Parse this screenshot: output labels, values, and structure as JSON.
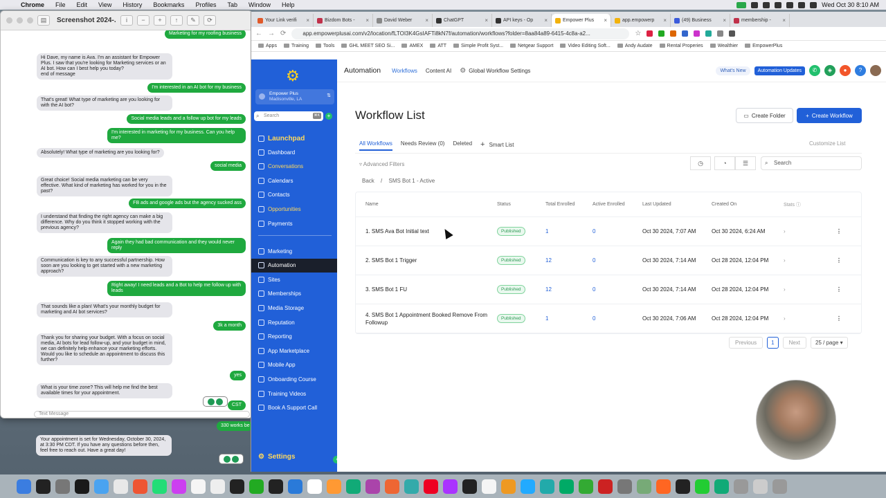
{
  "menubar": {
    "app": "Chrome",
    "menus": [
      "File",
      "Edit",
      "View",
      "History",
      "Bookmarks",
      "Profiles",
      "Tab",
      "Window",
      "Help"
    ],
    "clock": "Wed Oct 30 8:10 AM"
  },
  "screenshot_window": {
    "title": "Screenshot 2024-...",
    "input_placeholder": "Text Message",
    "messages": [
      {
        "from": "out",
        "text": "Marketing for my roofing business"
      },
      {
        "from": "in",
        "text": "Hi Dave, my name is Ava. I'm an assistant for Empower Plus. I saw that you're looking for Marketing services or an AI bot. How can I best help you today?\nend of message"
      },
      {
        "from": "out",
        "text": "I'm interested in an AI bot for my business"
      },
      {
        "from": "in",
        "text": "That's great! What type of marketing are you looking for with the AI bot?"
      },
      {
        "from": "out",
        "text": "Social media leads and a follow up bot for my leads"
      },
      {
        "from": "out",
        "text": "I'm interested in marketing for my business. Can you help me?"
      },
      {
        "from": "in",
        "text": "Absolutely! What type of marketing are you looking for?"
      },
      {
        "from": "out",
        "text": "social media"
      },
      {
        "from": "in",
        "text": "Great choice! Social media marketing can be very effective. What kind of marketing has worked for you in the past?"
      },
      {
        "from": "out",
        "text": "FB ads and google ads but the agency sucked ass"
      },
      {
        "from": "in",
        "text": "I understand that finding the right agency can make a big difference. Why do you think it stopped working with the previous agency?"
      },
      {
        "from": "out",
        "text": "Again they had bad communication and they would never reply"
      },
      {
        "from": "in",
        "text": "Communication is key to any successful partnership. How soon are you looking to get started with a new marketing approach?"
      },
      {
        "from": "out",
        "text": "Right away! I need leads and a Bot to help me follow up with leads"
      },
      {
        "from": "in",
        "text": "That sounds like a plan! What's your monthly budget for marketing and AI bot services?"
      },
      {
        "from": "out",
        "text": "3k a month"
      },
      {
        "from": "in",
        "text": "Thank you for sharing your budget. With a focus on social media, AI bots for lead follow-up, and your budget in mind, we can definitely help enhance your marketing efforts. Would you like to schedule an appointment to discuss this further?"
      },
      {
        "from": "out",
        "text": "yes"
      },
      {
        "from": "in",
        "text": "What is your time zone? This will help me find the best available times for your appointment."
      },
      {
        "from": "out",
        "text": "CST"
      }
    ],
    "below_messages": [
      {
        "from": "out",
        "text": "330 works be"
      },
      {
        "from": "in",
        "text": "Your appointment is set for Wednesday, October 30, 2024, at 3:30 PM CDT. If you have any questions before then, feel free to reach out. Have a great day!"
      }
    ]
  },
  "browser": {
    "tabs": [
      {
        "label": "Your Link verifi",
        "color": "#e05a2a"
      },
      {
        "label": "Bizdom Bots -",
        "color": "#c0314a"
      },
      {
        "label": "David Weber",
        "color": "#888888"
      },
      {
        "label": "ChatGPT",
        "color": "#333333"
      },
      {
        "label": "API keys - Op",
        "color": "#333333"
      },
      {
        "label": "Empower Plus",
        "color": "#f2b20c",
        "active": true
      },
      {
        "label": "app.empowerp",
        "color": "#f2b20c"
      },
      {
        "label": "(49) Business",
        "color": "#3b5bdb"
      },
      {
        "label": "membership -",
        "color": "#c0314a"
      }
    ],
    "url": "app.empowerplusai.com/v2/location/fLTOI3K4GsIAFTi8kN7f/automation/workflows?folder=8aa84a89-6415-4c8a-a2...",
    "bookmarks": [
      "Apps",
      "Training",
      "Tools",
      "GHL MEET SEO Si...",
      "AMEX",
      "ATT",
      "Simple Profit Syst...",
      "Netgear Support",
      "Video Editing Soft...",
      "Andy Audate",
      "Rental Properies",
      "Wealthier",
      "EmpowerPlus"
    ]
  },
  "sidebar": {
    "location_name": "Empower Plus",
    "location_sub": "Madisonville, LA",
    "search_placeholder": "Search",
    "search_kbd": "⌘K",
    "launchpad": "Launchpad",
    "items_top": [
      "Dashboard",
      "Conversations",
      "Calendars",
      "Contacts",
      "Opportunities",
      "Payments"
    ],
    "items_bottom": [
      "Marketing",
      "Automation",
      "Sites",
      "Memberships",
      "Media Storage",
      "Reputation",
      "Reporting",
      "App Marketplace",
      "Mobile App",
      "Onboarding Course",
      "Training Videos",
      "Book A Support Call"
    ],
    "settings": "Settings"
  },
  "topnav": {
    "title": "Automation",
    "tabs": [
      "Workflows",
      "Content AI",
      "Global Workflow Settings"
    ],
    "whats_new": "What's New",
    "updates": "Automation Updates"
  },
  "page": {
    "title": "Workflow List",
    "create_folder": "Create Folder",
    "create_workflow": "Create Workflow",
    "tabs": [
      "All Workflows",
      "Needs Review (0)",
      "Deleted",
      "Smart List"
    ],
    "customize": "Customize List",
    "advanced_filters": "Advanced Filters",
    "search_placeholder": "Search",
    "breadcrumb": {
      "back": "Back",
      "sep": "/",
      "current": "SMS Bot 1 - Active"
    }
  },
  "table": {
    "headers": {
      "name": "Name",
      "status": "Status",
      "total": "Total Enrolled",
      "active": "Active Enrolled",
      "updated": "Last Updated",
      "created": "Created On",
      "stats": "Stats"
    },
    "rows": [
      {
        "name": "1. SMS Ava Bot Initial text",
        "status": "Published",
        "total": "1",
        "active": "0",
        "updated": "Oct 30 2024, 7:07 AM",
        "created": "Oct 30 2024, 6:24 AM"
      },
      {
        "name": "2. SMS Bot 1 Trigger",
        "status": "Published",
        "total": "12",
        "active": "0",
        "updated": "Oct 30 2024, 7:14 AM",
        "created": "Oct 28 2024, 12:04 PM"
      },
      {
        "name": "3. SMS Bot 1 FU",
        "status": "Published",
        "total": "12",
        "active": "0",
        "updated": "Oct 30 2024, 7:14 AM",
        "created": "Oct 28 2024, 12:04 PM"
      },
      {
        "name": "4. SMS Bot 1 Appointment Booked Remove From Followup",
        "status": "Published",
        "total": "1",
        "active": "0",
        "updated": "Oct 30 2024, 7:06 AM",
        "created": "Oct 28 2024, 12:04 PM"
      }
    ]
  },
  "pagination": {
    "previous": "Previous",
    "page": "1",
    "next": "Next",
    "page_size": "25 / page"
  }
}
